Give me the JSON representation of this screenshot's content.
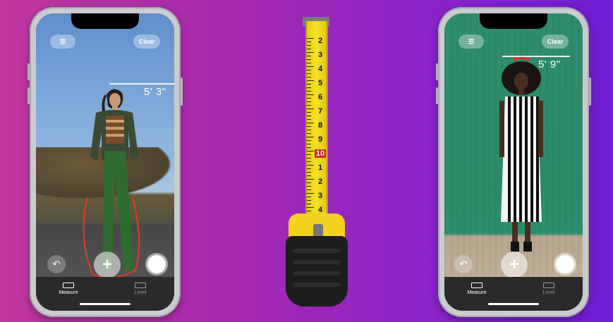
{
  "left_phone": {
    "clear_label": "Clear",
    "measurement": "5' 3\"",
    "tabs": [
      {
        "label": "Measure",
        "active": true
      },
      {
        "label": "Level",
        "active": false
      }
    ]
  },
  "right_phone": {
    "clear_label": "Clear",
    "measurement": "5' 9\"",
    "tabs": [
      {
        "label": "Measure",
        "active": true
      },
      {
        "label": "Level",
        "active": false
      }
    ]
  },
  "tape": {
    "numbers": [
      "2",
      "3",
      "4",
      "5",
      "6",
      "7",
      "8",
      "9",
      "10",
      "1",
      "2",
      "3",
      "4"
    ],
    "highlight": "10",
    "colors": {
      "blade": "#f5e323",
      "highlight": "#d9261c",
      "body": "#1d1d1d"
    }
  },
  "icons": [
    "list-icon",
    "undo-icon",
    "plus-icon",
    "shutter-icon",
    "ruler-icon",
    "level-icon"
  ]
}
